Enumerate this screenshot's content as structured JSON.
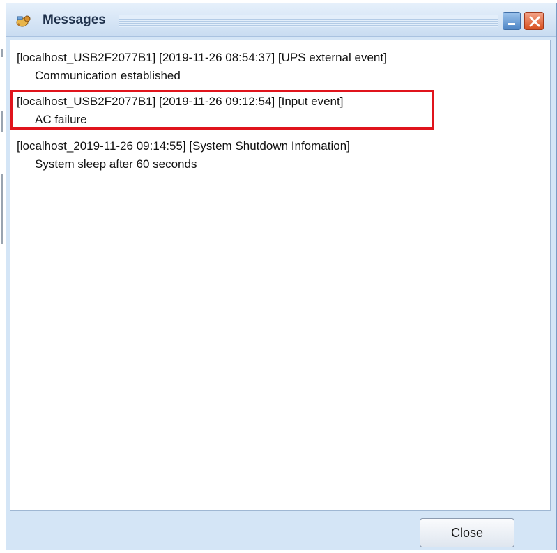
{
  "window": {
    "title": "Messages",
    "title_icon": "messages-app-icon",
    "minimize_icon": "minimize-icon",
    "close_icon": "close-x-icon"
  },
  "messages": [
    {
      "header": "[localhost_USB2F2077B1] [2019-11-26 08:54:37] [UPS external event]",
      "body": "Communication established",
      "highlighted": false
    },
    {
      "header": "[localhost_USB2F2077B1] [2019-11-26 09:12:54] [Input event]",
      "body": "AC failure",
      "highlighted": true
    },
    {
      "header": "[localhost_2019-11-26 09:14:55] [System Shutdown Infomation]",
      "body": "System sleep after 60 seconds",
      "highlighted": false
    }
  ],
  "footer": {
    "close_label": "Close"
  },
  "colors": {
    "highlight_border": "#e0141c",
    "titlebar": "#c9dcf1",
    "close_icon_bg": "#d8501f"
  }
}
